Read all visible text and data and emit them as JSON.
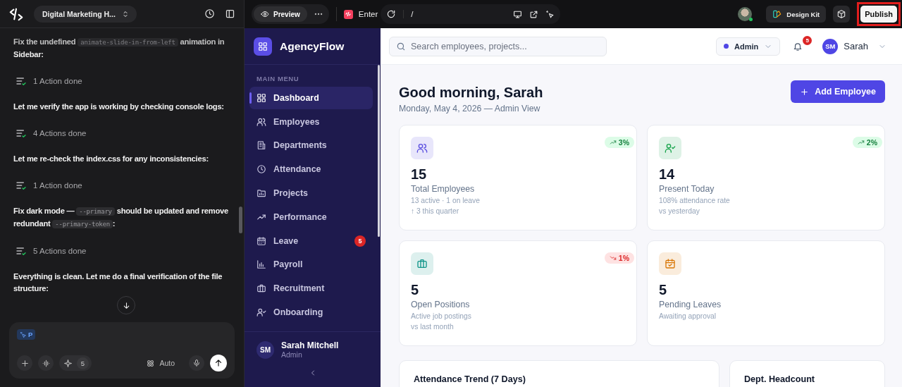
{
  "chat": {
    "project": "Digital Marketing H...",
    "items": [
      {
        "kind": "message",
        "parts": [
          {
            "kind": "text",
            "text": "Fix the undefined "
          },
          {
            "kind": "code",
            "text": "animate-slide-in-from-left"
          },
          {
            "kind": "text",
            "text": " animation in Sidebar:"
          }
        ]
      },
      {
        "kind": "actions",
        "text": "1 Action done"
      },
      {
        "kind": "message",
        "parts": [
          {
            "kind": "text",
            "text": "Let me verify the app is working by checking console logs:"
          }
        ]
      },
      {
        "kind": "actions",
        "text": "4 Actions done"
      },
      {
        "kind": "message",
        "parts": [
          {
            "kind": "text",
            "text": "Let me re-check the index.css for any inconsistencies:"
          }
        ]
      },
      {
        "kind": "actions",
        "text": "1 Action done"
      },
      {
        "kind": "message",
        "parts": [
          {
            "kind": "text",
            "text": "Fix dark mode — "
          },
          {
            "kind": "code",
            "text": "--primary"
          },
          {
            "kind": "text",
            "text": " should be updated and remove redundant "
          },
          {
            "kind": "code",
            "text": "--primary-token"
          },
          {
            "kind": "text",
            "text": ":"
          }
        ]
      },
      {
        "kind": "actions",
        "text": "5 Actions done"
      },
      {
        "kind": "message",
        "parts": [
          {
            "kind": "text",
            "text": "Everything is clean. Let me do a final verification of the file structure:"
          }
        ]
      }
    ],
    "composer": {
      "chip": "P",
      "credits": "5",
      "mode": "Auto"
    }
  },
  "preview_bar": {
    "tab": "Preview",
    "app_name": "Enter",
    "path": "/",
    "design_kit": "Design Kit",
    "publish": "Publish"
  },
  "app": {
    "sidebar": {
      "brand": "AgencyFlow",
      "menu_heading": "MAIN MENU",
      "nav": [
        {
          "label": "Dashboard",
          "selected": true
        },
        {
          "label": "Employees",
          "selected": false
        },
        {
          "label": "Departments",
          "selected": false
        },
        {
          "label": "Attendance",
          "selected": false
        },
        {
          "label": "Projects",
          "selected": false
        },
        {
          "label": "Performance",
          "selected": false
        },
        {
          "label": "Leave",
          "selected": false,
          "badge": "5"
        },
        {
          "label": "Payroll",
          "selected": false
        },
        {
          "label": "Recruitment",
          "selected": false
        },
        {
          "label": "Onboarding",
          "selected": false
        }
      ],
      "user": {
        "initials": "SM",
        "name": "Sarah Mitchell",
        "role": "Admin"
      }
    },
    "header": {
      "search": {
        "placeholder": "Search employees, projects..."
      },
      "role": "Admin",
      "notifications": "5",
      "account": {
        "initials": "SM",
        "name": "Sarah"
      }
    },
    "greeting": "Good morning, Sarah",
    "subtitle": "Monday, May 4, 2026 — Admin View",
    "add_button": "Add Employee",
    "stats": [
      {
        "color": "#5b4fe0",
        "trend": {
          "kind": "up",
          "text": "3%"
        },
        "value": "15",
        "label": "Total Employees",
        "notes": [
          "13 active · 1 on leave",
          "↑ 3 this quarter"
        ]
      },
      {
        "color": "#16a34a",
        "trend": {
          "kind": "up",
          "text": "2%"
        },
        "value": "14",
        "label": "Present Today",
        "notes": [
          "108% attendance rate",
          "vs yesterday"
        ]
      },
      {
        "color": "#0d9488",
        "trend": {
          "kind": "down",
          "text": "1%"
        },
        "value": "5",
        "label": "Open Positions",
        "notes": [
          "Active job postings",
          "vs last month"
        ]
      },
      {
        "color": "#d97706",
        "value": "5",
        "label": "Pending Leaves",
        "notes": [
          "Awaiting approval"
        ]
      }
    ],
    "panels": [
      {
        "title": "Attendance Trend (7 Days)"
      },
      {
        "title": "Dept. Headcount"
      }
    ]
  }
}
